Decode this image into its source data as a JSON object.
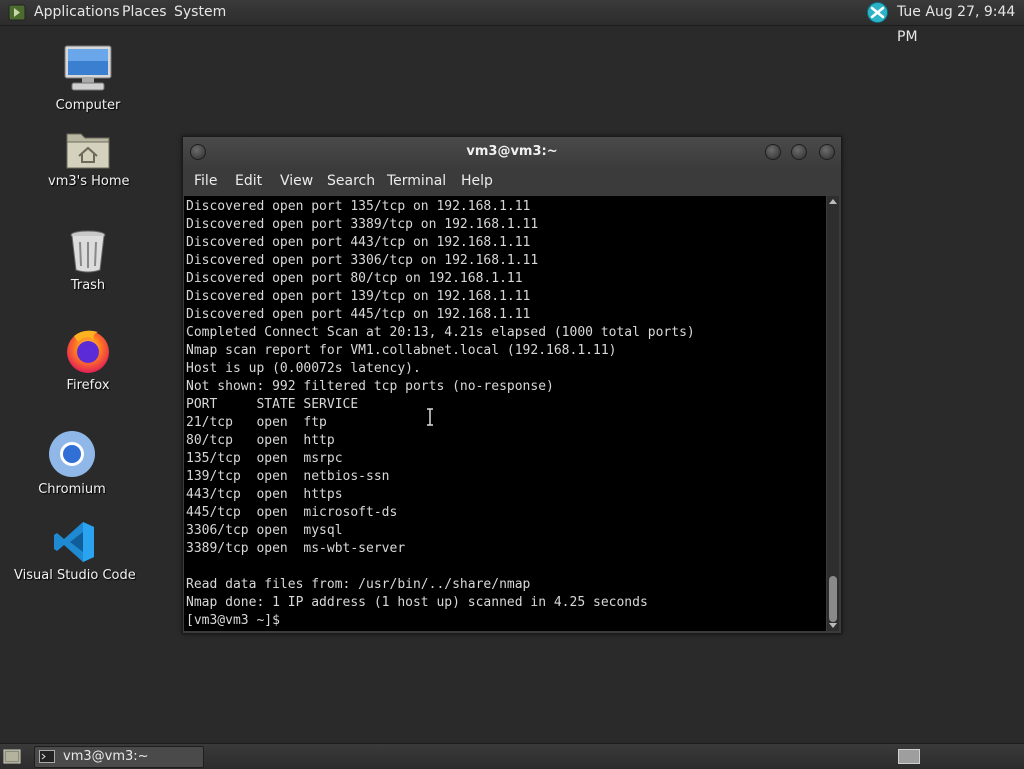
{
  "top_panel": {
    "menus": [
      "Applications",
      "Places",
      "System"
    ],
    "clock": "Tue Aug 27,  9:44 PM"
  },
  "desktop": {
    "icons": [
      {
        "label": "Computer",
        "icon": "computer-icon"
      },
      {
        "label": "vm3's Home",
        "icon": "home-folder-icon"
      },
      {
        "label": "Trash",
        "icon": "trash-icon"
      },
      {
        "label": "Firefox",
        "icon": "firefox-icon"
      },
      {
        "label": "Chromium",
        "icon": "chromium-icon"
      },
      {
        "label": "Visual Studio Code",
        "icon": "vscode-icon"
      }
    ]
  },
  "terminal": {
    "title": "vm3@vm3:~",
    "menus": [
      "File",
      "Edit",
      "View",
      "Search",
      "Terminal",
      "Help"
    ],
    "output": "Discovered open port 135/tcp on 192.168.1.11\nDiscovered open port 3389/tcp on 192.168.1.11\nDiscovered open port 443/tcp on 192.168.1.11\nDiscovered open port 3306/tcp on 192.168.1.11\nDiscovered open port 80/tcp on 192.168.1.11\nDiscovered open port 139/tcp on 192.168.1.11\nDiscovered open port 445/tcp on 192.168.1.11\nCompleted Connect Scan at 20:13, 4.21s elapsed (1000 total ports)\nNmap scan report for VM1.collabnet.local (192.168.1.11)\nHost is up (0.00072s latency).\nNot shown: 992 filtered tcp ports (no-response)\nPORT     STATE SERVICE\n21/tcp   open  ftp\n80/tcp   open  http\n135/tcp  open  msrpc\n139/tcp  open  netbios-ssn\n443/tcp  open  https\n445/tcp  open  microsoft-ds\n3306/tcp open  mysql\n3389/tcp open  ms-wbt-server\n\nRead data files from: /usr/bin/../share/nmap\nNmap done: 1 IP address (1 host up) scanned in 4.25 seconds\n[vm3@vm3 ~]$"
  },
  "taskbar": {
    "items": [
      {
        "label": "vm3@vm3:~"
      }
    ]
  }
}
